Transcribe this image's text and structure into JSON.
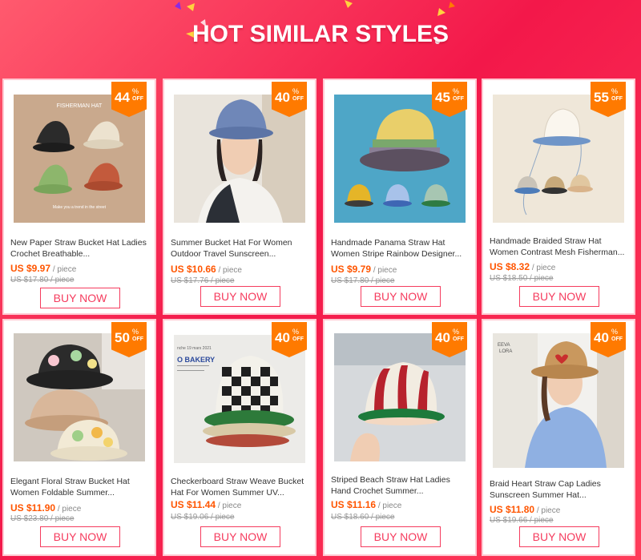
{
  "banner": {
    "title": "HOT SIMILAR STYLES"
  },
  "colors": {
    "accent": "#f53c5e",
    "price": "#ff5500",
    "badge": "#ff7a00"
  },
  "products": [
    {
      "discount": "44",
      "percent_sign": "%",
      "off_label": "OFF",
      "title": "New Paper Straw Bucket Hat Ladies Crochet Breathable...",
      "price": "US $9.97",
      "unit": " / piece",
      "old_price": "US $17.80 / piece",
      "buy_label": "BUY NOW",
      "image_texts": {
        "heading": "FISHERMAN HAT",
        "caption": "Make you a trend in the street"
      }
    },
    {
      "discount": "40",
      "percent_sign": "%",
      "off_label": "OFF",
      "title": "Summer Bucket Hat For Women Outdoor Travel Sunscreen...",
      "price": "US $10.66",
      "unit": " / piece",
      "old_price": "US $17.76 / piece",
      "buy_label": "BUY NOW"
    },
    {
      "discount": "45",
      "percent_sign": "%",
      "off_label": "OFF",
      "title": "Handmade Panama Straw Hat Women Stripe Rainbow Designer...",
      "price": "US $9.79",
      "unit": " / piece",
      "old_price": "US $17.80 / piece",
      "buy_label": "BUY NOW"
    },
    {
      "discount": "55",
      "percent_sign": "%",
      "off_label": "OFF",
      "title": "Handmade Braided Straw Hat Women Contrast Mesh Fisherman...",
      "price": "US $8.32",
      "unit": " / piece",
      "old_price": "US $18.50 / piece",
      "buy_label": "BUY NOW"
    },
    {
      "discount": "50",
      "percent_sign": "%",
      "off_label": "OFF",
      "title": "Elegant Floral Straw Bucket Hat Women Foldable Summer...",
      "price": "US $11.90",
      "unit": " / piece",
      "old_price": "US $23.80 / piece",
      "buy_label": "BUY NOW"
    },
    {
      "discount": "40",
      "percent_sign": "%",
      "off_label": "OFF",
      "title": "Checkerboard Straw Weave Bucket Hat For Women Summer UV...",
      "price": "US $11.44",
      "unit": " / piece",
      "old_price": "US $19.06 / piece",
      "buy_label": "BUY NOW",
      "image_texts": {
        "heading": "O BAKERY",
        "subheading": "nche 19 mars 2021"
      }
    },
    {
      "discount": "40",
      "percent_sign": "%",
      "off_label": "OFF",
      "title": "Striped Beach Straw Hat Ladies Hand Crochet Summer...",
      "price": "US $11.16",
      "unit": " / piece",
      "old_price": "US $18.60 / piece",
      "buy_label": "BUY NOW"
    },
    {
      "discount": "40",
      "percent_sign": "%",
      "off_label": "OFF",
      "title": "Braid Heart Straw Cap Ladies Sunscreen Summer Hat...",
      "price": "US $11.80",
      "unit": " / piece",
      "old_price": "US $19.66 / piece",
      "buy_label": "BUY NOW",
      "image_texts": {
        "heading": "EEVA",
        "subheading": "LORA"
      }
    }
  ]
}
